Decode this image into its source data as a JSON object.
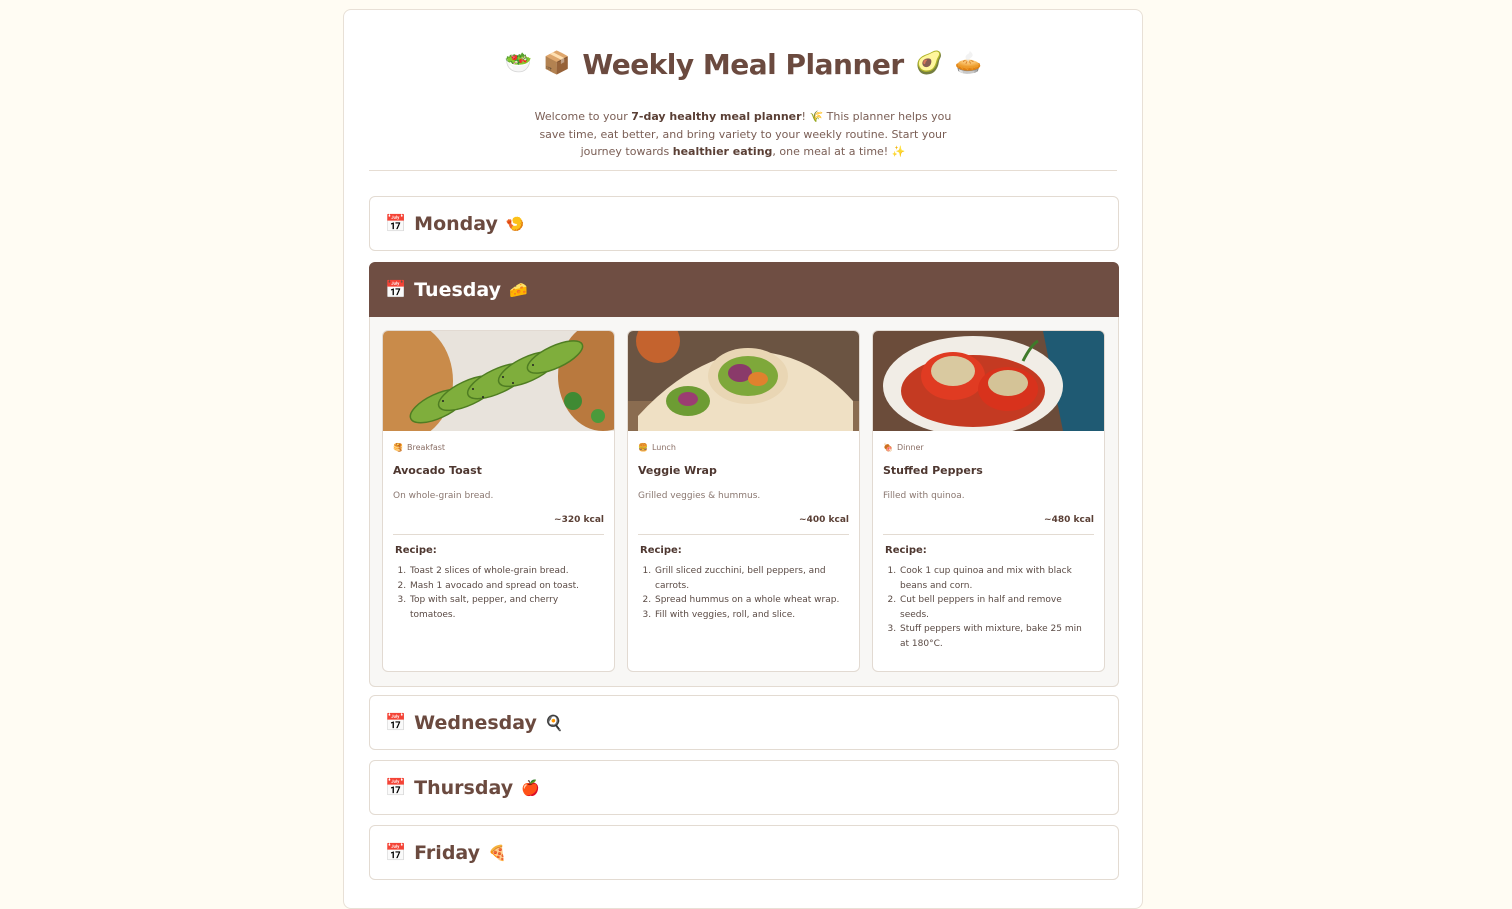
{
  "header": {
    "title": "Weekly Meal Planner",
    "emoji_left_1": "🥗",
    "emoji_left_2": "📦",
    "emoji_right_1": "🥑",
    "emoji_right_2": "🥧",
    "intro_1": "Welcome to your ",
    "intro_bold_1": "7-day healthy meal planner",
    "intro_2": "! 🌾 This planner helps you save time, eat better, and bring variety to your weekly routine. Start your journey towards ",
    "intro_bold_2": "healthier eating",
    "intro_3": ", one meal at a time! ✨"
  },
  "days": [
    {
      "name": "Monday",
      "emoji": "🍤"
    },
    {
      "name": "Tuesday",
      "emoji": "🧀"
    },
    {
      "name": "Wednesday",
      "emoji": "🍳"
    },
    {
      "name": "Thursday",
      "emoji": "🍎"
    },
    {
      "name": "Friday",
      "emoji": "🍕"
    }
  ],
  "calendar_icon": "📅",
  "tuesday_meals": [
    {
      "type": "Breakfast",
      "type_icon": "🥞",
      "name": "Avocado Toast",
      "desc": "On whole-grain bread.",
      "kcal": "~320 kcal",
      "recipe_label": "Recipe:",
      "steps": [
        "Toast 2 slices of whole-grain bread.",
        "Mash 1 avocado and spread on toast.",
        "Top with salt, pepper, and cherry tomatoes."
      ]
    },
    {
      "type": "Lunch",
      "type_icon": "🍔",
      "name": "Veggie Wrap",
      "desc": "Grilled veggies & hummus.",
      "kcal": "~400 kcal",
      "recipe_label": "Recipe:",
      "steps": [
        "Grill sliced zucchini, bell peppers, and carrots.",
        "Spread hummus on a whole wheat wrap.",
        "Fill with veggies, roll, and slice."
      ]
    },
    {
      "type": "Dinner",
      "type_icon": "🍖",
      "name": "Stuffed Peppers",
      "desc": "Filled with quinoa.",
      "kcal": "~480 kcal",
      "recipe_label": "Recipe:",
      "steps": [
        "Cook 1 cup quinoa and mix with black beans and corn.",
        "Cut bell peppers in half and remove seeds.",
        "Stuff peppers with mixture, bake 25 min at 180°C."
      ]
    }
  ]
}
